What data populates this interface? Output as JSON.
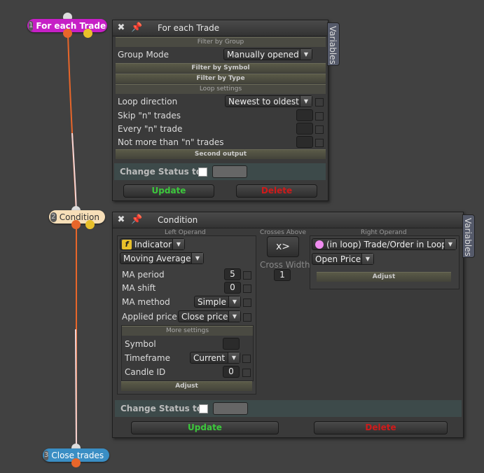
{
  "nodes": [
    {
      "num": "1",
      "label": "For each Trade",
      "color": "#c61fc6"
    },
    {
      "num": "2",
      "label": "Condition",
      "color": "#f7dfb8"
    },
    {
      "num": "3",
      "label": "Close trades",
      "color": "#3a8ec4"
    }
  ],
  "panel1": {
    "title": "For each Trade",
    "variables_tab": "Variables",
    "sections": {
      "filter_by_group": "Filter by Group",
      "filter_by_symbol": "Filter by Symbol",
      "filter_by_type": "Filter by Type",
      "loop_settings": "Loop settings",
      "second_output": "Second output"
    },
    "group_mode": {
      "label": "Group Mode",
      "value": "Manually opened"
    },
    "loop_direction": {
      "label": "Loop direction",
      "value": "Newest to oldest"
    },
    "skip_n": {
      "label": "Skip \"n\" trades"
    },
    "every_n": {
      "label": "Every \"n\" trade"
    },
    "not_more_than_n": {
      "label": "Not more than \"n\" trades"
    },
    "change_status": "Change Status to",
    "update": "Update",
    "delete": "Delete"
  },
  "panel2": {
    "title": "Condition",
    "variables_tab": "Variables",
    "left_operand": "Left Operand",
    "crosses_above": "Crosses Above",
    "right_operand": "Right Operand",
    "operator_symbol": "x>",
    "cross_width": {
      "label": "Cross Width",
      "value": "1"
    },
    "indicator_icon": "f",
    "indicator": "Indicator",
    "indicator_type": "Moving Average",
    "ma_period": {
      "label": "MA period",
      "value": "5"
    },
    "ma_shift": {
      "label": "MA shift",
      "value": "0"
    },
    "ma_method": {
      "label": "MA method",
      "value": "Simple"
    },
    "applied_price": {
      "label": "Applied price",
      "value": "Close price"
    },
    "more_settings": "More settings",
    "symbol": {
      "label": "Symbol"
    },
    "timeframe": {
      "label": "Timeframe",
      "value": "Current"
    },
    "candle_id": {
      "label": "Candle ID",
      "value": "0"
    },
    "adjust_left": "Adjust",
    "right_value": "(in loop) Trade/Order in Loop",
    "open_price": "Open Price",
    "adjust_right": "Adjust",
    "change_status": "Change Status to",
    "update": "Update",
    "delete": "Delete"
  },
  "colors": {
    "update_text": "#3cc83c",
    "delete_text": "#d01a1a",
    "wire_orange": "#e8662a",
    "wire_pink": "#f0c8c8"
  }
}
